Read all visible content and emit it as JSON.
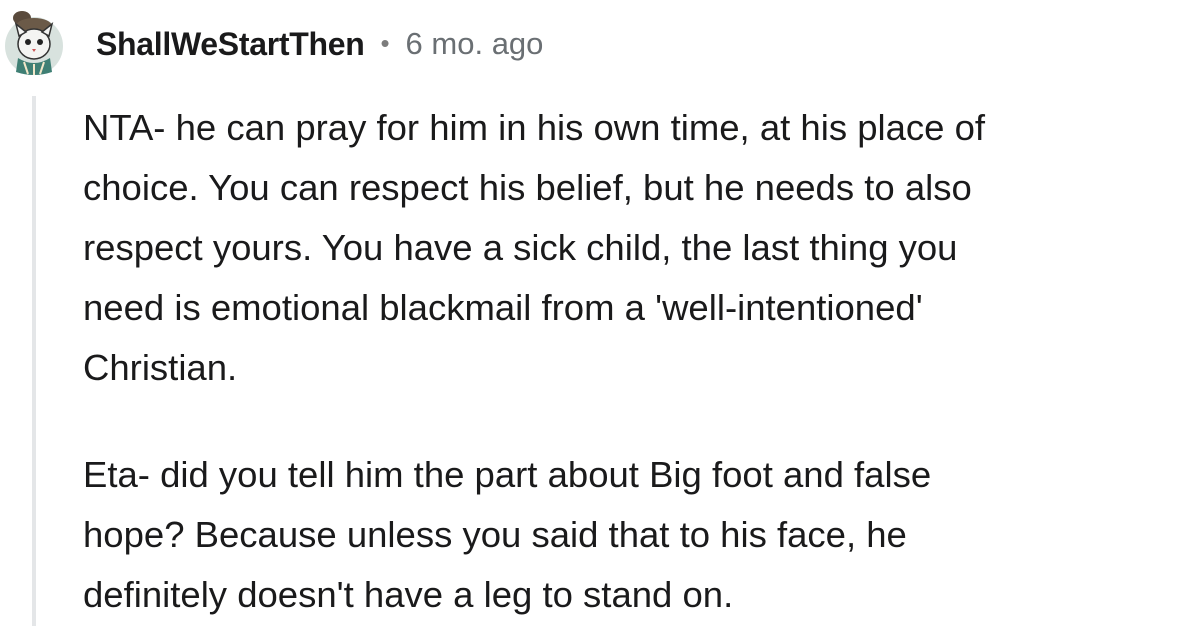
{
  "comment": {
    "username": "ShallWeStartThen",
    "separator": "•",
    "timestamp": "6 mo. ago",
    "avatar_icon": "cat-avatar-icon",
    "paragraphs": [
      {
        "lines": [
          "NTA- he can pray for him in his own time, at his place of",
          "choice. You can respect his belief, but he needs to also",
          "respect yours. You have a sick child, the last thing you",
          "need is emotional blackmail from a 'well-intentioned'",
          "Christian."
        ]
      },
      {
        "lines": [
          "Eta- did you tell him the part about Big foot and false",
          "hope? Because unless you said that to his face, he",
          "definitely doesn't have a leg to stand on."
        ]
      }
    ]
  },
  "colors": {
    "text": "#1a1a1b",
    "meta": "#6a6f73",
    "thread_line": "#e4e6e8",
    "avatar_bg": "#d8e2de"
  }
}
